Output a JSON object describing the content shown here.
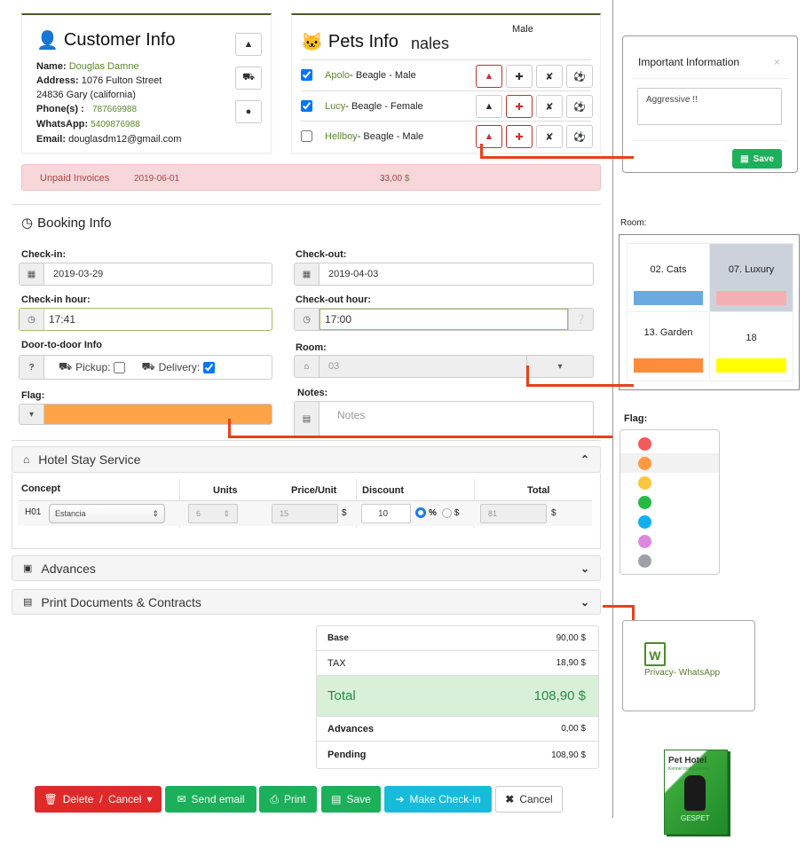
{
  "customer": {
    "title": "Customer Info",
    "name_label": "Name:",
    "name": "Douglas Damne",
    "address_label": "Address:",
    "address": "1076 Fulton Street",
    "city": "24836 Gary (california)",
    "phone_label": "Phone(s) :",
    "phone": "787669988",
    "whatsapp_label": "WhatsApp:",
    "whatsapp": "5409876988",
    "email_label": "Email:",
    "email": "douglasdm12@gmail.com"
  },
  "pets": {
    "title": "Pets Info",
    "overlay_text": "nales",
    "overlay_male": "Male",
    "items": [
      {
        "name": "Apolo",
        "desc": " - Beagle - Male",
        "checked": true
      },
      {
        "name": "Lucy",
        "desc": " - Beagle - Female",
        "checked": true
      },
      {
        "name": "Hellboy",
        "desc": " - Beagle -  Male",
        "checked": false
      }
    ]
  },
  "unpaid": {
    "label": "Unpaid Invoices",
    "date": "2019-06-01",
    "amount": "33,00",
    "currency": "$"
  },
  "booking": {
    "title": "Booking Info",
    "checkin_label": "Check-in:",
    "checkin": "2019-03-29",
    "checkout_label": "Check-out:",
    "checkout": "2019-04-03",
    "checkin_hour_label": "Check-in hour:",
    "checkin_hour": "17:41",
    "checkout_hour_label": "Check-out hour:",
    "checkout_hour": "17:00",
    "door_label": "Door-to-door Info",
    "door_help": "?",
    "pickup_label": "Pickup:",
    "delivery_label": "Delivery:",
    "room_label": "Room:",
    "room_value": "03",
    "flag_label": "Flag:",
    "flag_color": "#ffa347",
    "notes_label": "Notes:",
    "notes_placeholder": "Notes"
  },
  "hotel_stay": {
    "title": "Hotel Stay Service",
    "headers": {
      "concept": "Concept",
      "units": "Units",
      "price": "Price/Unit",
      "discount": "Discount",
      "total": "Total"
    },
    "row": {
      "code": "H01",
      "concept": "Estancia",
      "units": "6",
      "price": "15",
      "discount": "10",
      "pct": "%",
      "cur": "$",
      "total": "81"
    }
  },
  "advances_title": "Advances",
  "print_title": "Print Documents & Contracts",
  "totals": {
    "base_label": "Base",
    "base": "90,00 $",
    "tax_label": "TAX",
    "tax": "18,90 $",
    "total_label": "Total",
    "total": "108,90 $",
    "advances_label": "Advances",
    "advances": "0,00 $",
    "pending_label": "Pending",
    "pending": "108,90 $"
  },
  "actions": {
    "delete": "Delete  /  Cancel",
    "email": "Send email",
    "print": "Print",
    "save": "Save",
    "checkin": "Make Check-in",
    "cancel": "Cancel"
  },
  "important_modal": {
    "title": "Important Information",
    "close": "×",
    "text": "Aggressive !!",
    "save": "Save"
  },
  "room_picker": {
    "label": "Room:",
    "rooms": [
      {
        "name": "02. Cats",
        "color": "#6aaae0"
      },
      {
        "name": "07. Luxury",
        "color": "#f4b0b0"
      },
      {
        "name": "13. Garden",
        "color": "#ff8c3a"
      },
      {
        "name": "18",
        "color": "#ffff00"
      }
    ]
  },
  "flag_picker": {
    "label": "Flag:",
    "colors": [
      "#f55a5a",
      "#ff9a40",
      "#fcc740",
      "#22bb44",
      "#10b0ee",
      "#dd88dd",
      "#a0a0a8"
    ]
  },
  "document": {
    "label": "Privacy- WhatsApp",
    "icon_letter": "W"
  },
  "product": {
    "title": "Pet Hotel",
    "subtitle": "Kennel management",
    "brand": "GESPET"
  }
}
